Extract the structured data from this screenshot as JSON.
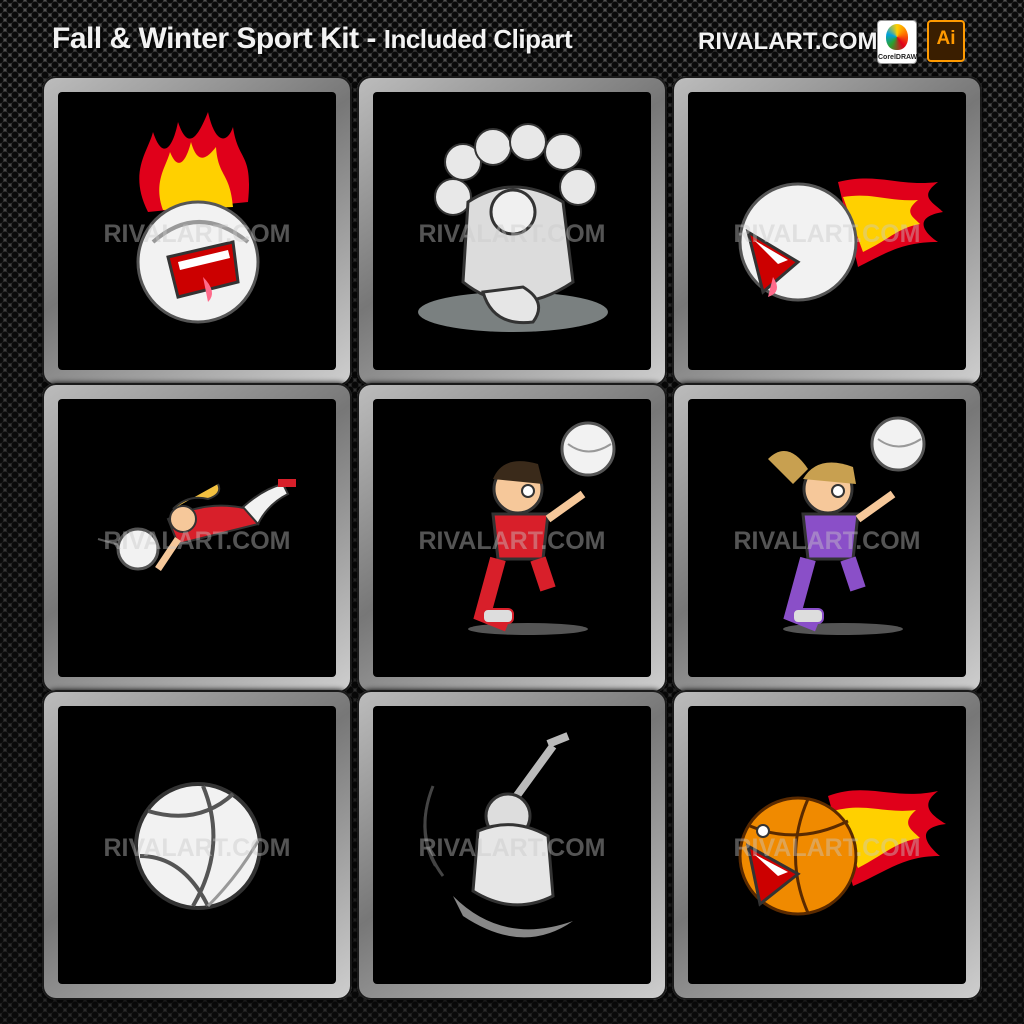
{
  "header": {
    "title": "Fall & Winter Sport Kit",
    "separator": " - ",
    "subtitle": "Included Clipart",
    "brand": "RIVALART.COM",
    "logos": [
      {
        "name": "coreldraw-logo",
        "text": "CorelDRAW"
      },
      {
        "name": "illustrator-logo",
        "text": "Ai"
      }
    ]
  },
  "watermark": "RIVALART.COM",
  "clipart": [
    {
      "name": "flaming-volleyball-mascot",
      "icon": "volleyball-fire-icon"
    },
    {
      "name": "football-team-monster",
      "icon": "football-monster-icon"
    },
    {
      "name": "flaming-volleyball-face",
      "icon": "volleyball-fire-icon"
    },
    {
      "name": "girl-diving-volleyball",
      "icon": "volleyball-player-icon"
    },
    {
      "name": "boy-volleyball-player",
      "icon": "volleyball-player-icon"
    },
    {
      "name": "girl-volleyball-player",
      "icon": "volleyball-player-icon"
    },
    {
      "name": "volleyball",
      "icon": "volleyball-icon"
    },
    {
      "name": "hockey-player",
      "icon": "hockey-player-icon"
    },
    {
      "name": "flaming-basketball-face",
      "icon": "basketball-fire-icon"
    }
  ],
  "colors": {
    "background": "#2a2a2a",
    "frame": "#9a9a9a",
    "tile": "#000000",
    "flame": "#ff3b00",
    "flame_inner": "#ffd000",
    "volleyball": "#f2f2f2",
    "basketball": "#f08a00",
    "jersey_boy": "#d81f2a",
    "jersey_girl": "#8a4fc8"
  }
}
